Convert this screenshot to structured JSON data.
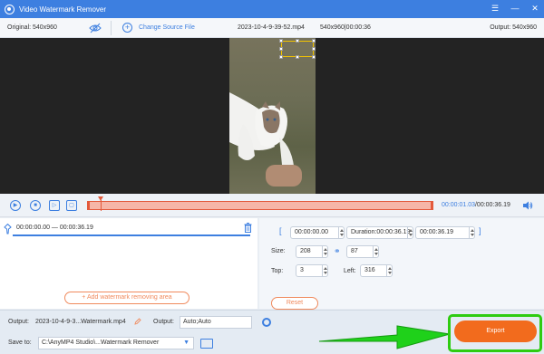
{
  "app": {
    "title": "Video Watermark Remover"
  },
  "info": {
    "original": "Original: 540x960",
    "change_source": "Change Source File",
    "filename": "2023-10-4-9-39-52.mp4",
    "file_dims": "540x960|00:00:36",
    "output": "Output: 540x960"
  },
  "timeline": {
    "current": "00:00:01.03",
    "total": "/00:00:36.19",
    "playhead_fraction": 0.04
  },
  "segment": {
    "range": "00:00:00.00 — 00:00:36.19"
  },
  "add_area_label": "Add watermark removing area",
  "range": {
    "start": "00:00:00.00",
    "duration_label": "Duration:00:00:36.19",
    "end": "00:00:36.19"
  },
  "size": {
    "label": "Size:",
    "width": "208",
    "height": "87"
  },
  "position": {
    "top_label": "Top:",
    "top": "3",
    "left_label": "Left:",
    "left": "316"
  },
  "reset_label": "Reset",
  "bottom": {
    "output_label": "Output:",
    "output_file": "2023-10-4-9-3...Watermark.mp4",
    "output_format_label": "Output:",
    "output_format": "Auto;Auto",
    "save_label": "Save to:",
    "save_path": "C:\\AnyMP4 Studio\\...Watermark Remover"
  },
  "export_label": "Export",
  "colors": {
    "accent": "#3d7fe0",
    "orange": "#f26b1d",
    "highlight": "#2ecc11"
  }
}
